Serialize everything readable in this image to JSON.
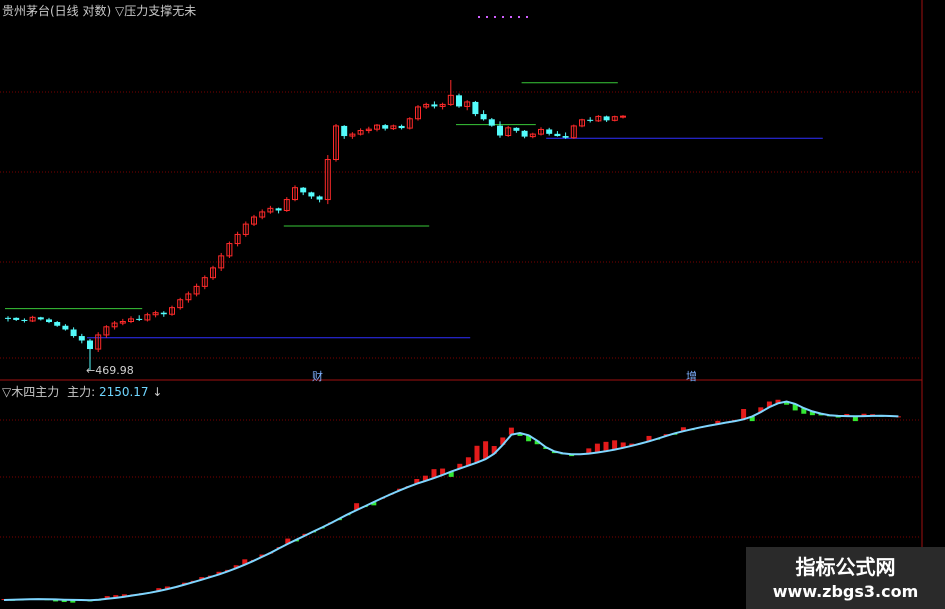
{
  "header": {
    "title_left": "贵州茅台(日线 对数)",
    "title_right": "▽压力支撑无未"
  },
  "lower": {
    "indicator_name": "▽木四主力",
    "main_label": "主力:",
    "main_value": "2150.17",
    "arrow": "↓"
  },
  "annotations": {
    "low_price": "←469.98",
    "mark_1": "财",
    "mark_2": "增"
  },
  "watermark": {
    "line1": "指标公式网",
    "line2": "www.zbgs3.com"
  },
  "colors": {
    "up": "#ff2a2a",
    "down": "#54fcfc",
    "resistance": "#39c839",
    "support": "#2f2fff",
    "line": "#7fd6ff",
    "bar_up": "#e31b1b",
    "bar_down": "#33e833",
    "grid": "#7a0000",
    "divider": "#a01010"
  },
  "chart_data": [
    {
      "type": "candlestick",
      "series": [
        {
          "values": [
            [
              560,
              565,
              555,
              562,
              0
            ],
            [
              562,
              563,
              556,
              558,
              0
            ],
            [
              558,
              561,
              553,
              556,
              0
            ],
            [
              556,
              566,
              554,
              563,
              1
            ],
            [
              563,
              564,
              557,
              559,
              0
            ],
            [
              559,
              562,
              552,
              554,
              0
            ],
            [
              554,
              556,
              545,
              547,
              0
            ],
            [
              547,
              550,
              538,
              540,
              0
            ],
            [
              540,
              544,
              525,
              528,
              0
            ],
            [
              528,
              532,
              515,
              520,
              0
            ],
            [
              520,
              523,
              470,
              505,
              0
            ],
            [
              505,
              535,
              500,
              530,
              1
            ],
            [
              530,
              548,
              525,
              545,
              1
            ],
            [
              545,
              556,
              540,
              552,
              1
            ],
            [
              552,
              560,
              548,
              555,
              1
            ],
            [
              555,
              565,
              552,
              560,
              1
            ],
            [
              560,
              567,
              556,
              558,
              0
            ],
            [
              558,
              572,
              555,
              568,
              1
            ],
            [
              568,
              576,
              563,
              572,
              1
            ],
            [
              572,
              575,
              564,
              569,
              0
            ],
            [
              569,
              586,
              566,
              582,
              1
            ],
            [
              582,
              602,
              578,
              598,
              1
            ],
            [
              598,
              615,
              592,
              610,
              1
            ],
            [
              610,
              632,
              605,
              626,
              1
            ],
            [
              626,
              650,
              620,
              645,
              1
            ],
            [
              645,
              672,
              640,
              667,
              1
            ],
            [
              667,
              702,
              660,
              695,
              1
            ],
            [
              695,
              730,
              690,
              725,
              1
            ],
            [
              725,
              755,
              718,
              748,
              1
            ],
            [
              748,
              782,
              742,
              775,
              1
            ],
            [
              775,
              800,
              770,
              794,
              1
            ],
            [
              794,
              815,
              788,
              808,
              1
            ],
            [
              808,
              825,
              803,
              818,
              1
            ],
            [
              818,
              820,
              804,
              812,
              0
            ],
            [
              812,
              850,
              808,
              843,
              1
            ],
            [
              843,
              885,
              838,
              878,
              1
            ],
            [
              878,
              880,
              856,
              864,
              0
            ],
            [
              864,
              866,
              845,
              852,
              0
            ],
            [
              852,
              855,
              835,
              843,
              0
            ],
            [
              843,
              982,
              830,
              967,
              1
            ],
            [
              967,
              1092,
              960,
              1085,
              1
            ],
            [
              1085,
              1088,
              1038,
              1048,
              0
            ],
            [
              1048,
              1062,
              1038,
              1055,
              1
            ],
            [
              1055,
              1076,
              1050,
              1068,
              1
            ],
            [
              1068,
              1082,
              1058,
              1073,
              1
            ],
            [
              1073,
              1092,
              1065,
              1088,
              1
            ],
            [
              1088,
              1092,
              1068,
              1075,
              0
            ],
            [
              1075,
              1090,
              1070,
              1085,
              1
            ],
            [
              1085,
              1090,
              1072,
              1077,
              0
            ],
            [
              1077,
              1118,
              1072,
              1112,
              1
            ],
            [
              1112,
              1165,
              1105,
              1158,
              1
            ],
            [
              1158,
              1175,
              1150,
              1168,
              1
            ],
            [
              1168,
              1180,
              1152,
              1160,
              0
            ],
            [
              1160,
              1175,
              1148,
              1168,
              1
            ],
            [
              1168,
              1270,
              1162,
              1205,
              1
            ],
            [
              1205,
              1212,
              1155,
              1160,
              0
            ],
            [
              1160,
              1185,
              1145,
              1178,
              1
            ],
            [
              1178,
              1182,
              1122,
              1130,
              0
            ],
            [
              1130,
              1145,
              1105,
              1110,
              0
            ],
            [
              1110,
              1115,
              1082,
              1086,
              0
            ],
            [
              1086,
              1102,
              1042,
              1050,
              0
            ],
            [
              1050,
              1085,
              1045,
              1078,
              1
            ],
            [
              1078,
              1080,
              1060,
              1067,
              0
            ],
            [
              1067,
              1070,
              1040,
              1046,
              0
            ],
            [
              1046,
              1060,
              1040,
              1055,
              1
            ],
            [
              1055,
              1080,
              1050,
              1072,
              1
            ],
            [
              1072,
              1078,
              1050,
              1056,
              0
            ],
            [
              1056,
              1066,
              1046,
              1048,
              0
            ],
            [
              1048,
              1061,
              1038,
              1042,
              0
            ],
            [
              1042,
              1090,
              1038,
              1085,
              1
            ],
            [
              1085,
              1112,
              1080,
              1108,
              1
            ],
            [
              1108,
              1118,
              1098,
              1104,
              0
            ],
            [
              1104,
              1126,
              1100,
              1121,
              1
            ],
            [
              1121,
              1124,
              1100,
              1106,
              0
            ],
            [
              1106,
              1124,
              1102,
              1120,
              1
            ],
            [
              1120,
              1126,
              1113,
              1122,
              1
            ]
          ]
        }
      ],
      "level_lines": [
        {
          "kind": "resistance",
          "value": 580
        },
        {
          "kind": "support",
          "value": 525
        },
        {
          "kind": "resistance",
          "value": 770
        },
        {
          "kind": "resistance",
          "value": 1090
        },
        {
          "kind": "resistance",
          "value": 1258
        },
        {
          "kind": "support",
          "value": 1040
        }
      ],
      "extreme_low": 469.98
    },
    {
      "type": "bar_line",
      "series": [
        {
          "values": [
            602,
            604,
            606,
            608,
            610,
            609,
            607,
            605,
            603,
            602,
            600,
            605,
            612,
            620,
            630,
            641,
            652,
            664,
            678,
            694,
            712,
            732,
            752,
            773,
            795,
            818,
            843,
            870,
            900,
            932,
            965,
            1000,
            1038,
            1075,
            1110,
            1145,
            1180,
            1214,
            1250,
            1288,
            1325,
            1360,
            1394,
            1428,
            1462,
            1495,
            1526,
            1555,
            1582,
            1606,
            1630,
            1656,
            1684,
            1710,
            1735,
            1760,
            1790,
            1835,
            1910,
            1995,
            2010,
            1990,
            1945,
            1890,
            1855,
            1838,
            1830,
            1830,
            1836,
            1845,
            1856,
            1870,
            1885,
            1902,
            1920,
            1940,
            1962,
            1985,
            2007,
            2025,
            2042,
            2058,
            2072,
            2085,
            2098,
            2110,
            2125,
            2150,
            2186,
            2228,
            2260,
            2275,
            2255,
            2220,
            2192,
            2173,
            2160,
            2154,
            2152,
            2151,
            2152,
            2154,
            2155,
            2153,
            2150
          ]
        },
        {
          "values": [
            610,
            603,
            598,
            612,
            615,
            600,
            590,
            585,
            580,
            596,
            590,
            602,
            635,
            643,
            650,
            650,
            660,
            668,
            702,
            716,
            714,
            748,
            764,
            795,
            808,
            840,
            856,
            895,
            945,
            940,
            985,
            1002,
            1048,
            1120,
            1096,
            1160,
            1172,
            1209,
            1256,
            1275,
            1320,
            1418,
            1386,
            1400,
            1464,
            1498,
            1540,
            1562,
            1622,
            1650,
            1705,
            1710,
            1640,
            1750,
            1805,
            1902,
            1940,
            1900,
            1972,
            2055,
            1985,
            1940,
            1915,
            1875,
            1840,
            1830,
            1815,
            1832,
            1880,
            1920,
            1935,
            1948,
            1930,
            1920,
            1925,
            1985,
            1958,
            2000,
            1995,
            2058,
            2040,
            2060,
            2075,
            2112,
            2100,
            2120,
            2212,
            2110,
            2226,
            2275,
            2290,
            2248,
            2200,
            2172,
            2160,
            2158,
            2150,
            2140,
            2170,
            2110,
            2172,
            2168,
            2150,
            2155,
            2150
          ]
        }
      ]
    }
  ]
}
